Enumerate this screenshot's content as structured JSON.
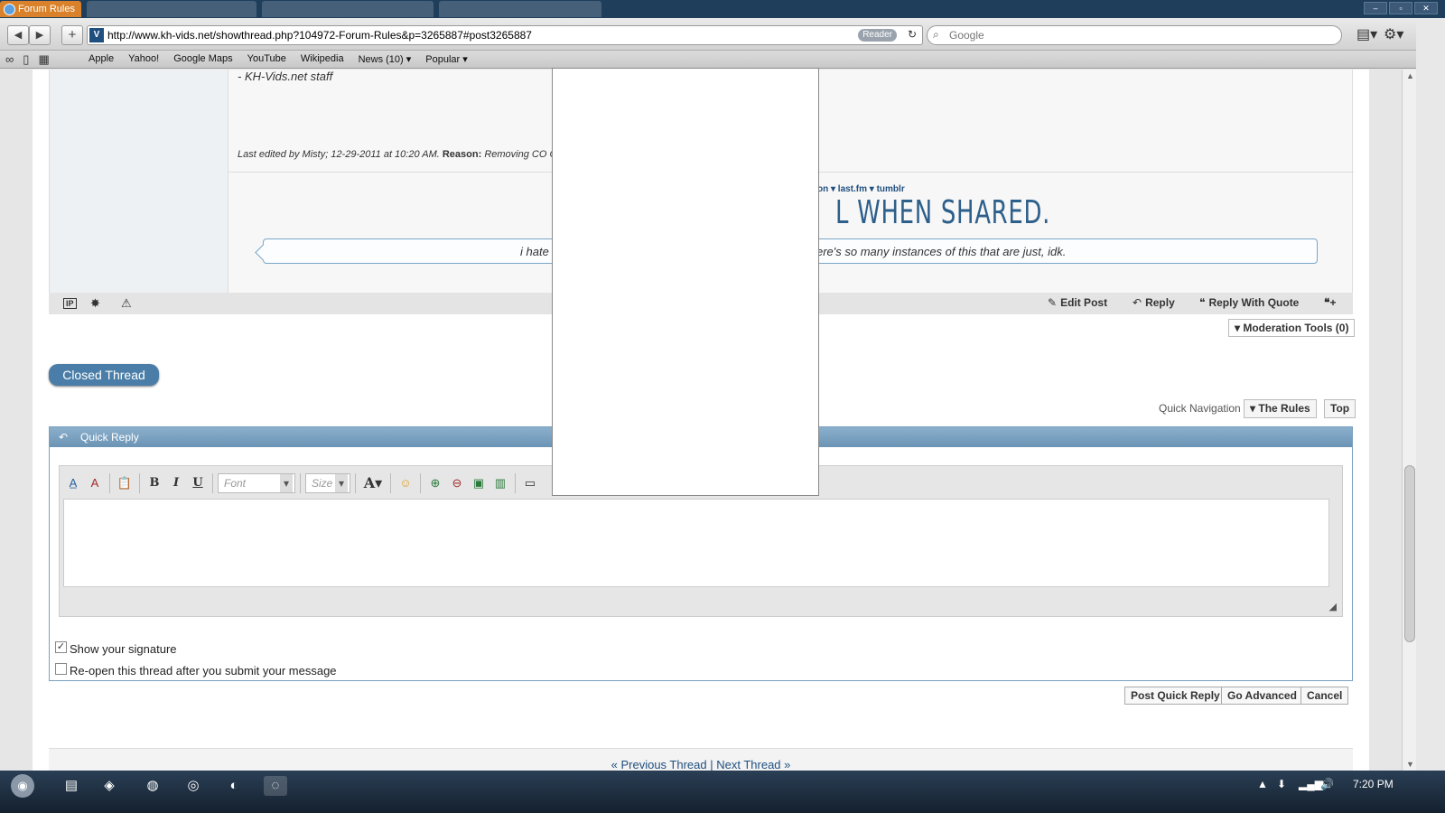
{
  "browser": {
    "active_tab": "Forum Rules",
    "url": "http://www.kh-vids.net/showthread.php?104972-Forum-Rules&p=3265887#post3265887",
    "reader_label": "Reader",
    "search_placeholder": "Google"
  },
  "bookmarks": [
    "Apple",
    "Yahoo!",
    "Google Maps",
    "YouTube",
    "Wikipedia",
    "News (10) ▾",
    "Popular ▾"
  ],
  "post": {
    "staff_signature": "- KH-Vids.net staff",
    "last_edited_prefix": "Last edited by Misty; 12-29-2011 at 10:20 AM.",
    "reason_label": "Reason:",
    "reason_text": "Removing CO Ca",
    "sig_links": "on ▾ last.fm ▾ tumblr",
    "sig_big": "L WHEN SHARED.",
    "quote_left": "i hate",
    "quote_right": "ere's so many instances of this that are just, idk."
  },
  "post_footer": {
    "ip_icon": "IP",
    "edit_post": "Edit Post",
    "reply": "Reply",
    "reply_with_quote": "Reply With Quote"
  },
  "mod_tools": "▾ Moderation Tools (0)",
  "closed_thread": "Closed Thread",
  "quick_nav": {
    "label": "Quick Navigation",
    "rules": "▾ The Rules",
    "top": "Top"
  },
  "quick_reply": {
    "title": "Quick Reply",
    "font_placeholder": "Font",
    "size_placeholder": "Size",
    "show_signature": "Show your signature",
    "show_signature_checked": true,
    "reopen_thread": "Re-open this thread after you submit your message",
    "reopen_checked": false,
    "post_button": "Post Quick Reply",
    "advanced_button": "Go Advanced",
    "cancel_button": "Cancel"
  },
  "thread_nav": {
    "prev": "« Previous Thread",
    "sep": " | ",
    "next": "Next Thread »"
  },
  "taskbar": {
    "clock": "7:20 PM"
  }
}
